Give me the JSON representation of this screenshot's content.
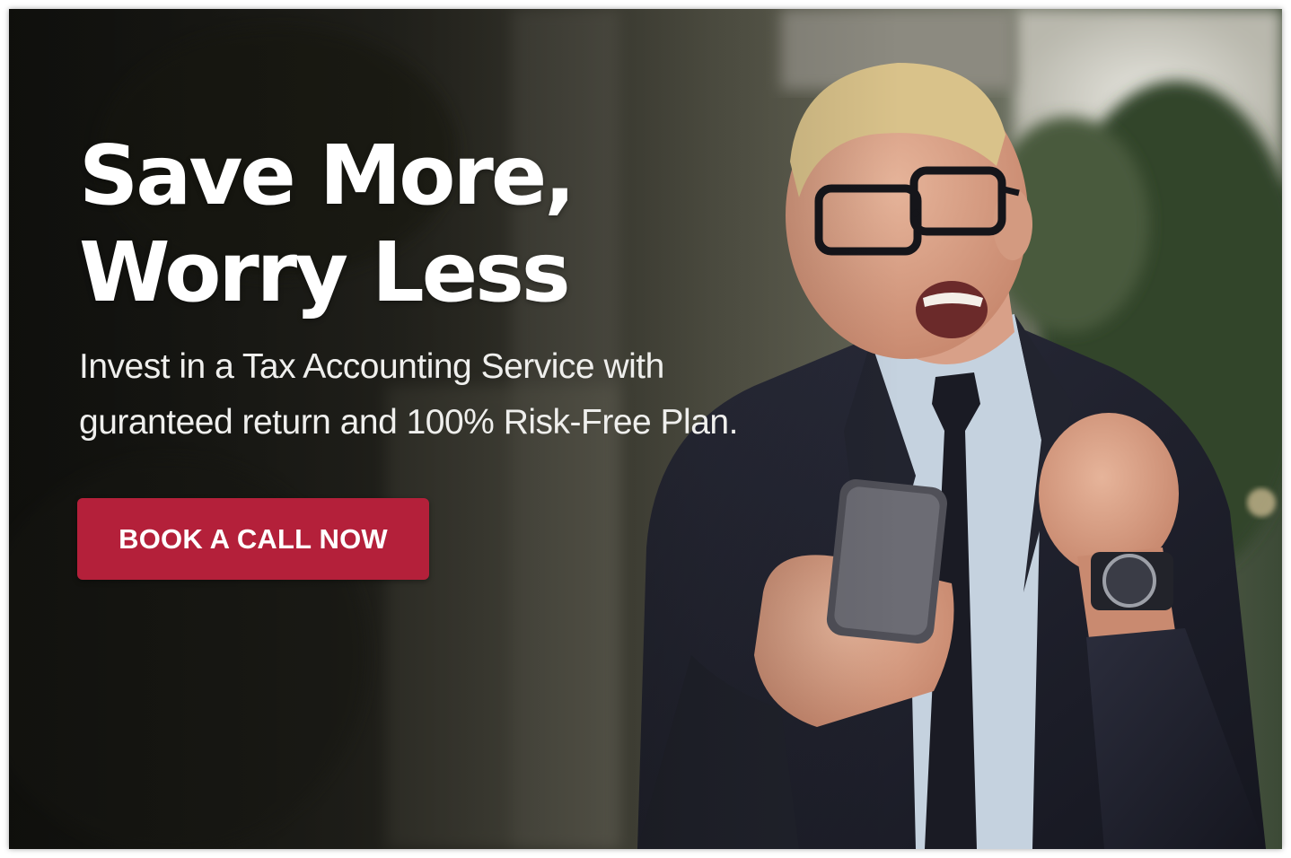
{
  "banner": {
    "headline_line1": "Save More,",
    "headline_line2": "Worry Less",
    "subtext_line1": "Invest in a Tax Accounting Service with",
    "subtext_line2": "guranteed return and 100% Risk-Free Plan.",
    "cta_label": "BOOK A CALL NOW"
  },
  "colors": {
    "cta_background": "#b4203a",
    "headline_text": "#ffffff",
    "subtext": "#efefed"
  }
}
